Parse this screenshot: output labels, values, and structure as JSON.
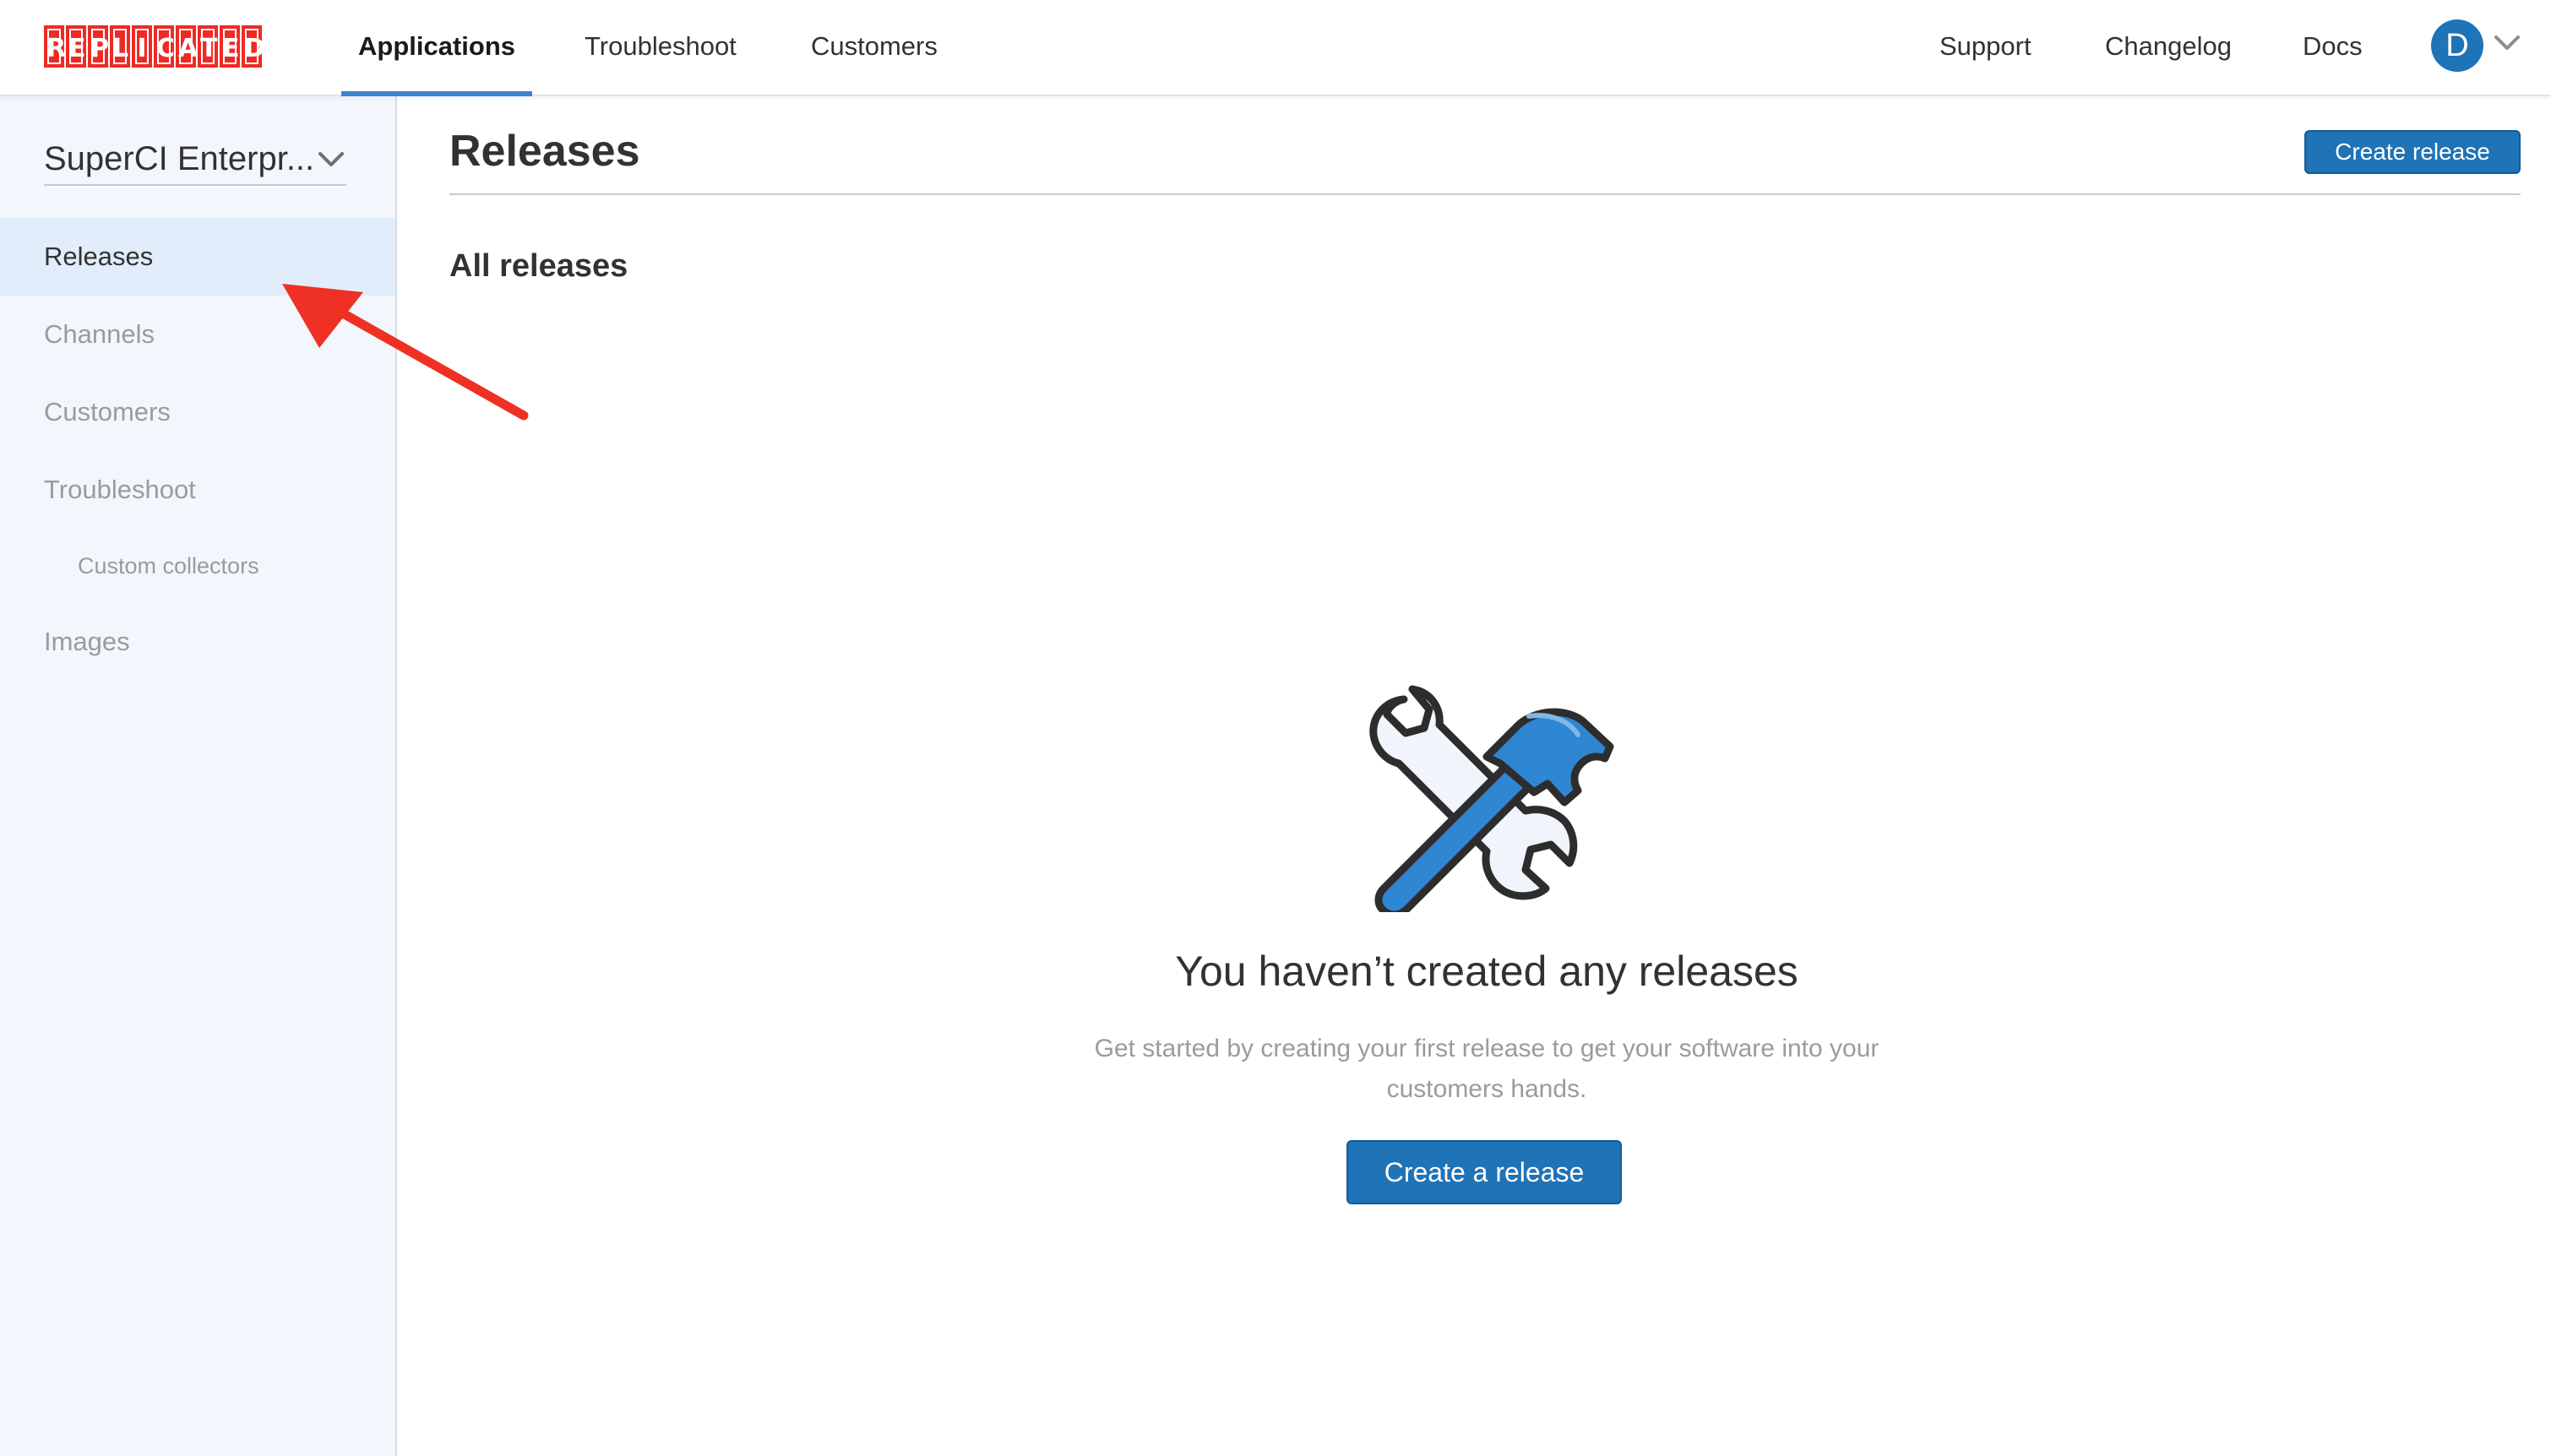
{
  "logo": {
    "letters": [
      "R",
      "E",
      "P",
      "L",
      "I",
      "C",
      "A",
      "T",
      "E",
      "D"
    ],
    "brand_color": "#ef2a25"
  },
  "topnav": {
    "tabs": [
      {
        "label": "Applications",
        "active": true
      },
      {
        "label": "Troubleshoot",
        "active": false
      },
      {
        "label": "Customers",
        "active": false
      }
    ],
    "right_links": [
      {
        "label": "Support"
      },
      {
        "label": "Changelog"
      },
      {
        "label": "Docs"
      }
    ],
    "avatar_initial": "D",
    "accent_color": "#3b84d1"
  },
  "sidebar": {
    "app_selector": {
      "value": "SuperCI Enterpr...",
      "icon": "chevron-down-icon"
    },
    "items": [
      {
        "label": "Releases",
        "active": true
      },
      {
        "label": "Channels",
        "active": false
      },
      {
        "label": "Customers",
        "active": false
      },
      {
        "label": "Troubleshoot",
        "active": false
      },
      {
        "label": "Custom collectors",
        "active": false,
        "sub": true
      },
      {
        "label": "Images",
        "active": false
      }
    ],
    "background_color": "#f3f7fd",
    "active_background_color": "#e1edfb"
  },
  "main": {
    "title": "Releases",
    "create_button_label": "Create release",
    "section_title": "All releases",
    "empty_state": {
      "icon": "wrench-hammer-icon",
      "title": "You haven’t created any releases",
      "description": "Get started by creating your first release to get your software into your customers hands.",
      "button_label": "Create a release"
    },
    "button_color": "#1f73b7"
  },
  "annotation": {
    "icon": "red-arrow-annotation",
    "color": "#ee3124"
  }
}
